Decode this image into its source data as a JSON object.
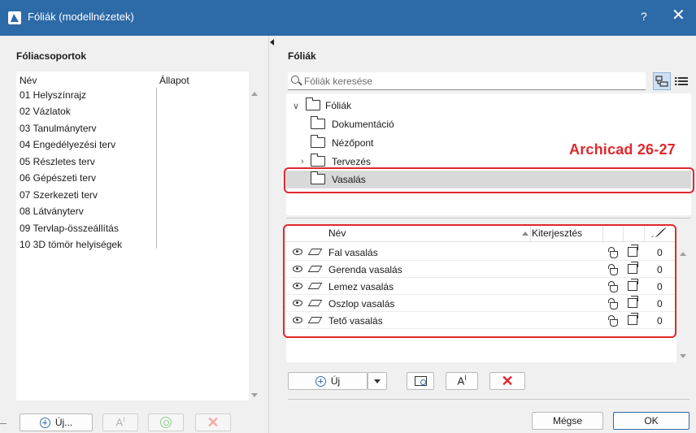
{
  "window": {
    "title": "Fóliák (modellnézetek)",
    "help": "?",
    "close": "✕"
  },
  "left": {
    "section_title": "Fóliacsoportok",
    "col_name": "Név",
    "col_status": "Állapot",
    "groups": [
      "01 Helyszínrajz",
      "02 Vázlatok",
      "03 Tanulmányterv",
      "04 Engedélyezési terv",
      "05 Részletes terv",
      "06 Gépészeti terv",
      "07 Szerkezeti terv",
      "08 Látványterv",
      "09 Tervlap-összeállítás",
      "10 3D tömör helyiségek"
    ],
    "buttons": {
      "new_label": "Új...",
      "rename_label": "A",
      "rename_sup": "I"
    }
  },
  "right": {
    "section_title": "Fóliák",
    "search_placeholder": "Fóliák keresése",
    "tree": {
      "root": "Fóliák",
      "folders": [
        "Dokumentáció",
        "Nézőpont",
        "Tervezés",
        "Vasalás"
      ],
      "selected": "Vasalás"
    },
    "annotation": "Archicad 26-27",
    "table": {
      "col_name": "Név",
      "col_extent": "Kiterjesztés",
      "rows": [
        {
          "name": "Fal vasalás",
          "num": "0"
        },
        {
          "name": "Gerenda vasalás",
          "num": "0"
        },
        {
          "name": "Lemez vasalás",
          "num": "0"
        },
        {
          "name": "Oszlop vasalás",
          "num": "0"
        },
        {
          "name": "Tető vasalás",
          "num": "0"
        }
      ]
    },
    "buttons": {
      "new_label": "Új",
      "rename_label": "A",
      "rename_sup": "I"
    },
    "footer": {
      "cancel_label": "Mégse",
      "ok_label": "OK"
    }
  },
  "colors": {
    "titlebar": "#2d6aa8",
    "annotation_red": "#e0282e"
  }
}
